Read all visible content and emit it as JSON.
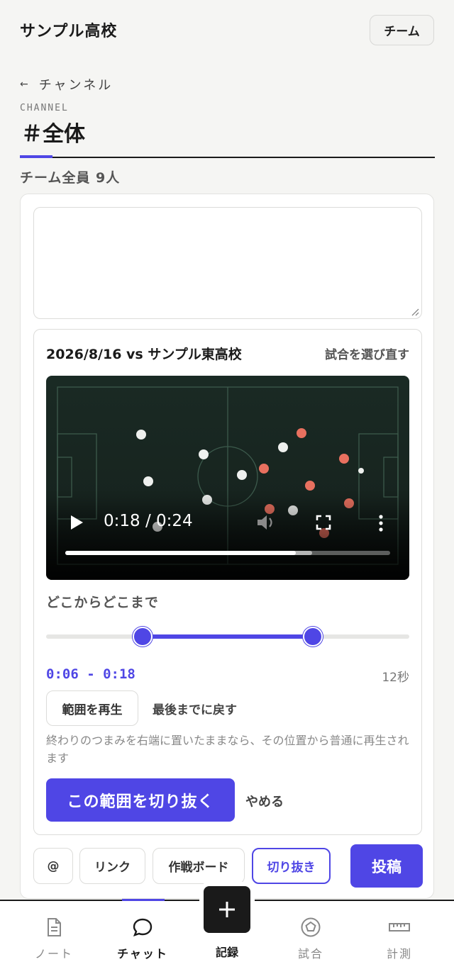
{
  "header": {
    "title": "サンプル高校",
    "team_button": "チーム"
  },
  "channel": {
    "back_label": "チャンネル",
    "back_arrow": "←",
    "label": "CHANNEL",
    "name": "＃全体",
    "member_count": "チーム全員 9人"
  },
  "composer": {
    "message_value": "",
    "clip": {
      "match_title": "2026/8/16 vs サンプル東高校",
      "reselect_label": "試合を選び直す",
      "video": {
        "time_display": "0:18 / 0:24",
        "progress_fraction": 0.71,
        "buffered_fraction": 0.76
      },
      "range": {
        "label": "どこからどこまで",
        "start_fraction": 0.265,
        "end_fraction": 0.735,
        "time_text": "0:06 - 0:18",
        "duration_text": "12秒"
      },
      "play_range_label": "範囲を再生",
      "reset_end_label": "最後までに戻す",
      "hint": "終わりのつまみを右端に置いたままなら、その位置から普通に再生されます",
      "cut_label": "この範囲を切り抜く",
      "cancel_label": "やめる"
    },
    "toolbar": {
      "mention_label": "@",
      "link_label": "リンク",
      "board_label": "作戦ボード",
      "clip_label": "切り抜き",
      "post_label": "投稿"
    }
  },
  "bottom_nav": {
    "items": [
      {
        "label": "ノート",
        "icon": "note-icon"
      },
      {
        "label": "チャット",
        "icon": "chat-icon",
        "active": true
      },
      {
        "label": "記録",
        "icon": "plus-icon"
      },
      {
        "label": "試合",
        "icon": "pentagon-icon"
      },
      {
        "label": "計測",
        "icon": "ruler-icon"
      }
    ]
  },
  "colors": {
    "accent": "#4f46e5",
    "dark": "#1a1a1a"
  }
}
